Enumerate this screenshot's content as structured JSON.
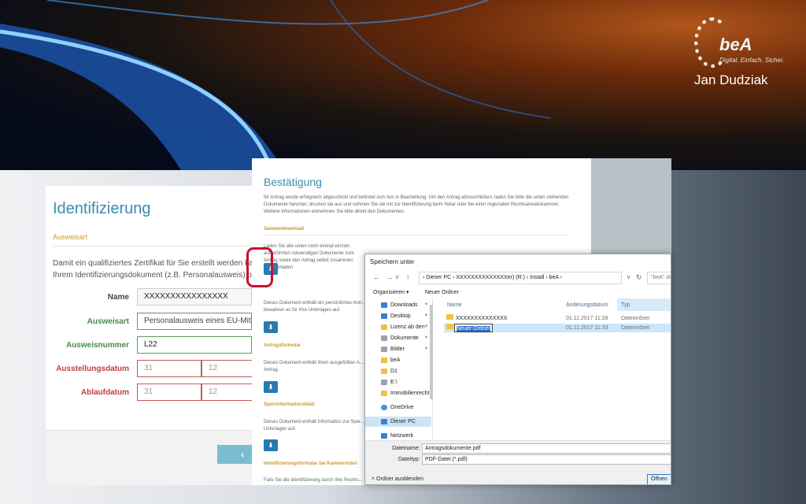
{
  "logo": {
    "bea": "beA",
    "tagline": "Digital. Einfach. Sicher.",
    "author": "Jan Dudziak"
  },
  "ident": {
    "title": "Identifizierung",
    "subtitle": "Ausweisart",
    "intro_lines": [
      "Damit ein qualifiziertes Zertifikat für Sie erstellt werden ka",
      "Ihrem Identifizierungsdokument (z.B. Personalausweis) be"
    ],
    "fields": {
      "name": {
        "label": "Name",
        "value": "XXXXXXXXXXXXXXXX"
      },
      "ausweisart": {
        "label": "Ausweisart",
        "value": "Personalausweis eines EU-Mitg"
      },
      "ausweisnummer": {
        "label": "Ausweisnummer",
        "value": "L22"
      },
      "ausstellungsdatum": {
        "label": "Ausstellungsdatum",
        "day": "31",
        "month": "12"
      },
      "ablaufdatum": {
        "label": "Ablaufdatum",
        "day": "31",
        "month": "12"
      }
    },
    "back_label": "‹"
  },
  "confirm": {
    "title": "Bestätigung",
    "intro": "Ihr Antrag wurde erfolgreich abgeschickt und befindet sich nun in Bearbeitung. Um den Antrag abzuschließen, laden Sie bitte die unten stehenden Dokumente herunter, drucken sie aus und nehmen Sie sie mit zur Identifizierung beim Notar oder bei einer regionalen Rechtsanwaltskammer. Weitere Informationen entnehmen Sie bitte direkt den Dokumenten.",
    "sections": [
      {
        "heading": "Sammeldownload",
        "text": "Laden Sie alle unten noch einmal einzeln aufgeführten notwendigen Dokumente zum Antrag sowie den Antrag selbst zusammen herunterladen"
      },
      {
        "heading": "",
        "text": "Dieses Dokument enthält ein persönliches Antr... bewahren es für Ihre Unterlagen auf."
      },
      {
        "heading": "Antragsformular",
        "text": "Dieses Dokument enthält Ihren ausgefüllten A... Antrag."
      },
      {
        "heading": "Sperrinformationsblatt",
        "text": "Dieses Dokument enthält Information zur Sper... Unterlagen auf."
      },
      {
        "heading": "Identifizierungsformular bei Kammernden",
        "text": "Falls Sie die Identifizierung durch Ihre Rechts..."
      }
    ],
    "download_icon": "download-arrow"
  },
  "dialog": {
    "title": "Speichern unter",
    "path": "›  Dieser PC  ›  XXXXXXXXXXXXXXer) (R:)  ›  Install  ›  beA  ›",
    "search_placeholder": "\"beA\" dur",
    "toolbar": {
      "organize": "Organisieren ▾",
      "new_folder": "Neuer Ordner"
    },
    "sidebar": [
      {
        "label": "Downloads",
        "icon": "download-icon",
        "pinned": true
      },
      {
        "label": "Desktop",
        "icon": "desktop-icon",
        "pinned": true
      },
      {
        "label": "Lizenz ab den",
        "icon": "folder-icon",
        "pinned": true
      },
      {
        "label": "Dokumente",
        "icon": "documents-icon",
        "pinned": true
      },
      {
        "label": "Bilder",
        "icon": "pictures-icon",
        "pinned": true
      },
      {
        "label": "beA",
        "icon": "folder-icon",
        "pinned": false
      },
      {
        "label": "D1",
        "icon": "folder-icon",
        "pinned": false
      },
      {
        "label": "E:\\",
        "icon": "drive-icon",
        "pinned": false
      },
      {
        "label": "Immobilienrecht",
        "icon": "folder-icon",
        "pinned": false
      },
      {
        "label": "OneDrive",
        "icon": "cloud-icon",
        "pinned": false
      },
      {
        "label": "Dieser PC",
        "icon": "computer-icon",
        "pinned": false
      },
      {
        "label": "Netzwerk",
        "icon": "network-icon",
        "pinned": false
      }
    ],
    "columns": {
      "name": "Name",
      "date": "Änderungsdatum",
      "type": "Typ"
    },
    "files": [
      {
        "name": "XXXXXXXXXXXXXX",
        "date": "01.11.2017 11:28",
        "type": "Dateiordner"
      },
      {
        "name": "Neuer Ordner",
        "date": "01.11.2017 11:33",
        "type": "Dateiordner"
      }
    ],
    "filename_label": "Dateiname:",
    "filename_value": "Antragsdokumente.pdf",
    "filetype_label": "Dateityp:",
    "filetype_value": "PDF-Datei (*.pdf)",
    "hide_folders": "Ordner ausblenden",
    "open_button": "Öffnen"
  }
}
